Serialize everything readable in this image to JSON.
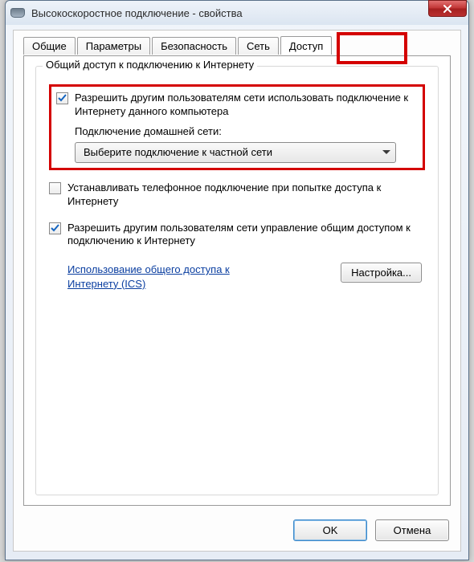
{
  "window": {
    "title": "Высокоскоростное подключение - свойства"
  },
  "tabs": {
    "items": [
      {
        "label": "Общие"
      },
      {
        "label": "Параметры"
      },
      {
        "label": "Безопасность"
      },
      {
        "label": "Сеть"
      },
      {
        "label": "Доступ"
      }
    ],
    "active_index": 4
  },
  "group": {
    "title": "Общий доступ к подключению к Интернету",
    "check_allow": "Разрешить другим пользователям сети использовать подключение к Интернету данного компьютера",
    "home_net_label": "Подключение домашней сети:",
    "combo_value": "Выберите подключение к частной сети",
    "check_dial": "Устанавливать телефонное подключение при попытке доступа к Интернету",
    "check_manage": "Разрешить другим пользователям сети управление общим доступом к подключению к Интернету",
    "link": "Использование общего доступа к Интернету (ICS)",
    "settings_button": "Настройка..."
  },
  "buttons": {
    "ok": "OK",
    "cancel": "Отмена"
  },
  "colors": {
    "highlight": "#d40000",
    "link": "#0a3ea0"
  }
}
